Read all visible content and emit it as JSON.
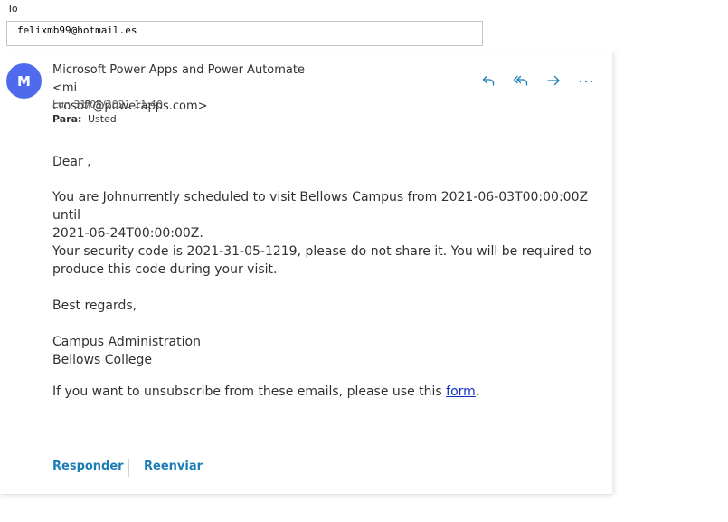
{
  "compose": {
    "to_label": "To",
    "to_value": "felixmb99@hotmail.es"
  },
  "message": {
    "avatar_initial": "M",
    "sender_line1": "Microsoft Power Apps and Power Automate <mi",
    "sender_line2": "crosoft@powerapps.com>",
    "date": "Lun 31/05/2021 11:40",
    "recipients_label": "Para:",
    "recipients_value": "Usted",
    "actions": {
      "reply_icon": "reply-icon",
      "reply_all_icon": "reply-all-icon",
      "forward_icon": "forward-icon",
      "more_icon": "more-icon",
      "accent": "#1b7db5"
    },
    "body": {
      "greeting": "Dear ,",
      "paragraph1_line1": "You are Johnurrently scheduled to visit Bellows Campus from 2021-06-03T00:00:00Z until",
      "paragraph1_line2": "2021-06-24T00:00:00Z.",
      "paragraph2_line1": "Your security code is 2021-31-05-1219, please do not share it. You will be required to",
      "paragraph2_line2": "produce this code during your visit.",
      "closing": "Best regards,",
      "signature_line1": "Campus Administration",
      "signature_line2": "Bellows College",
      "unsubscribe_text": "If you want to unsubscribe from these emails, please use this ",
      "unsubscribe_link": "form",
      "unsubscribe_end": "."
    },
    "footer": {
      "reply_label": "Responder",
      "forward_label": "Reenviar"
    }
  }
}
